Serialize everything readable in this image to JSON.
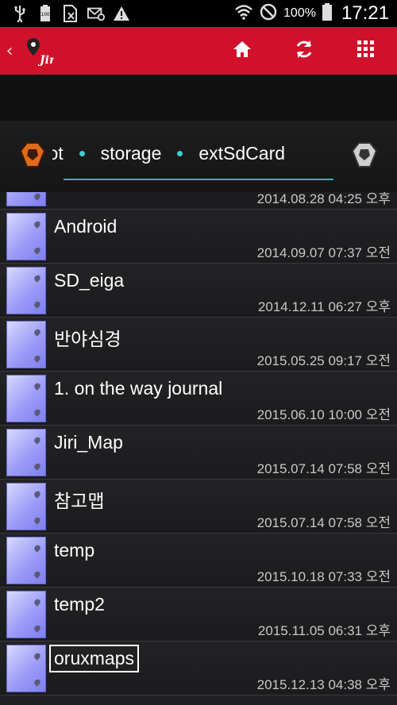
{
  "status_bar": {
    "icons": [
      "usb-icon",
      "battery-100-icon",
      "no-sim-icon",
      "mail-settings-icon",
      "warning-icon"
    ],
    "right_icons": [
      "wifi-icon",
      "do-not-disturb-icon"
    ],
    "battery": "100%",
    "time": "17:21"
  },
  "app_bar": {
    "back": "‹",
    "logo_text": "Jiri",
    "actions": [
      "home-icon",
      "refresh-icon",
      "grid-menu-icon"
    ],
    "color": "#d0112b"
  },
  "breadcrumb": {
    "items": [
      "root",
      "storage",
      "extSdCard"
    ],
    "accent": "#2fb5b5"
  },
  "files": [
    {
      "name": "",
      "date": "2014.08.28 04:25 오후",
      "partial": true
    },
    {
      "name": "Android",
      "date": "2014.09.07 07:37 오전"
    },
    {
      "name": "SD_eiga",
      "date": "2014.12.11 06:27 오후"
    },
    {
      "name": "반야심경",
      "date": "2015.05.25 09:17 오전"
    },
    {
      "name": "1. on the way journal",
      "date": "2015.06.10 10:00 오전"
    },
    {
      "name": "Jiri_Map",
      "date": "2015.07.14 07:58 오전"
    },
    {
      "name": "참고맵",
      "date": "2015.07.14 07:58 오전"
    },
    {
      "name": "temp",
      "date": "2015.10.18 07:33 오전"
    },
    {
      "name": "temp2",
      "date": "2015.11.05 06:31 오후"
    },
    {
      "name": "oruxmaps",
      "date": "2015.12.13 04:38 오후",
      "selected": true
    }
  ]
}
